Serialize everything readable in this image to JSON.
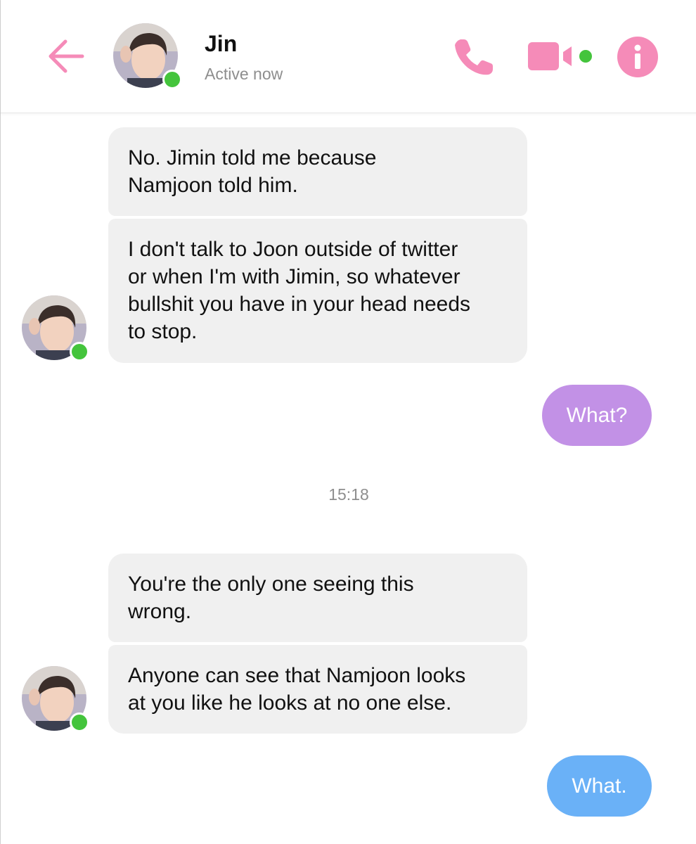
{
  "header": {
    "back_icon": "arrow-left-icon",
    "contact_name": "Jin",
    "status": "Active now",
    "call_icon": "phone-icon",
    "video_icon": "video-camera-icon",
    "info_icon": "info-icon",
    "accent_color": "#f58bb8"
  },
  "messages": [
    {
      "from": "contact",
      "text": "No. Jimin told me because\nNamjoon told him."
    },
    {
      "from": "contact",
      "text": "I don't talk to Joon outside of twitter\nor when I'm with Jimin, so whatever\nbullshit you have in your head needs\nto stop."
    },
    {
      "from": "me",
      "text": "What?",
      "color": "#c291e6"
    },
    {
      "from": "contact",
      "text": "You're the only one seeing this\nwrong."
    },
    {
      "from": "contact",
      "text": "Anyone can see that Namjoon looks\nat you like he looks at no one else."
    },
    {
      "from": "me",
      "text": "What.",
      "color": "#6ab1f7"
    }
  ],
  "timestamp": "15:18",
  "colors": {
    "incoming_bubble": "#f0f0f0",
    "online_dot": "#44c43c"
  }
}
